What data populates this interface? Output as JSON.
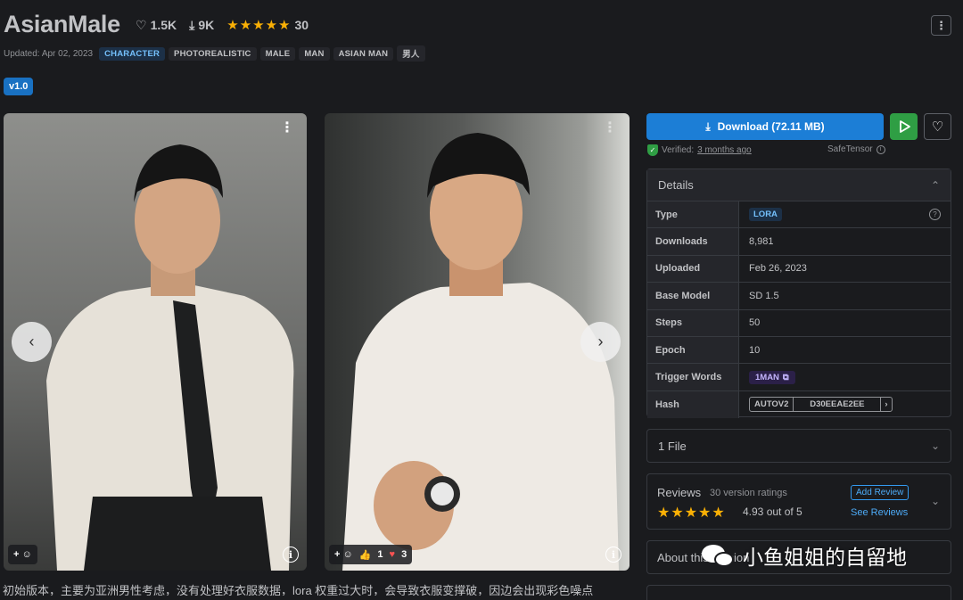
{
  "header": {
    "title": "AsianMale",
    "likes": "1.5K",
    "downloads": "9K",
    "rating_stars": "★★★★★",
    "rating_count": "30",
    "updated": "Updated: Apr 02, 2023",
    "tags": [
      "CHARACTER",
      "PHOTOREALISTIC",
      "MALE",
      "MAN",
      "ASIAN MAN",
      "男人"
    ],
    "version": "v1.0"
  },
  "gallery": {
    "image1": {
      "reactions": "+ ☺"
    },
    "image2": {
      "reactions": "+ ☺",
      "like_count": "1",
      "heart_count": "3"
    },
    "info_icon": "i"
  },
  "description": "初始版本，主要为亚洲男性考虑，没有处理好衣服数据，lora 权重过大时，会导致衣服变撑破，因边会出现彩色噪点",
  "download": {
    "label": "Download (72.11 MB)",
    "verified_prefix": "Verified:",
    "verified_link": "3 months ago",
    "safetensor": "SafeTensor"
  },
  "details": {
    "heading": "Details",
    "type_label": "Type",
    "type_value": "LORA",
    "downloads_label": "Downloads",
    "downloads_value": "8,981",
    "uploaded_label": "Uploaded",
    "uploaded_value": "Feb 26, 2023",
    "base_model_label": "Base Model",
    "base_model_value": "SD 1.5",
    "steps_label": "Steps",
    "steps_value": "50",
    "epoch_label": "Epoch",
    "epoch_value": "10",
    "trigger_label": "Trigger Words",
    "trigger_value": "1MAN",
    "hash_label": "Hash",
    "hash_type": "AUTOV2",
    "hash_value": "D30EEAE2EE"
  },
  "files": {
    "label": "1 File"
  },
  "reviews": {
    "title": "Reviews",
    "count": "30 version ratings",
    "stars": "★★★★★",
    "score": "4.93 out of 5",
    "add_review": "Add Review",
    "see_reviews": "See Reviews"
  },
  "about": {
    "label": "About this version"
  },
  "watermark": {
    "text": "小鱼姐姐的自留地"
  },
  "colors": {
    "accent": "#1c7ed6",
    "play": "#2f9e44",
    "star": "#fab005",
    "background": "#1a1b1e"
  }
}
